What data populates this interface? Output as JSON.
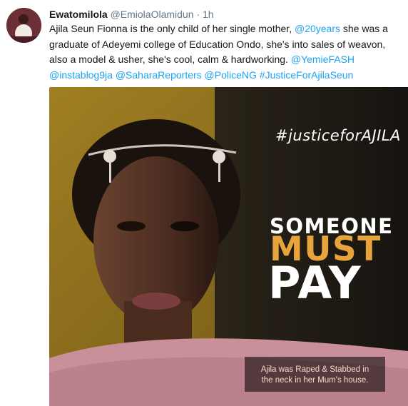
{
  "tweet": {
    "display_name": "Ewatomilola",
    "handle": "@EmiolaOlamidun",
    "separator": "·",
    "time": "1h",
    "text_parts": [
      {
        "text": "Ajila Seun Fionna is the only child of her single mother, ",
        "link": false
      },
      {
        "text": "@20years",
        "link": true
      },
      {
        "text": " she was a graduate of Adeyemi college of Education Ondo, she's into sales of weavon, also a model & usher, she's cool, calm & hardworking. ",
        "link": false
      },
      {
        "text": "@YemieFASH",
        "link": true
      },
      {
        "text": " ",
        "link": false
      },
      {
        "text": "@instablog9ja",
        "link": true
      },
      {
        "text": " ",
        "link": false
      },
      {
        "text": "@SaharaReporters",
        "link": true
      },
      {
        "text": " ",
        "link": false
      },
      {
        "text": "@PoliceNG",
        "link": true
      },
      {
        "text": " ",
        "link": false
      },
      {
        "text": "#JusticeForAjilaSeun",
        "link": true
      }
    ]
  },
  "media": {
    "hashtag": "#justiceforAJILA",
    "headline_line1": "SOMEONE",
    "headline_line2": "MUST",
    "headline_line3": "PAY",
    "caption_line1": "Ajila was Raped & Stabbed in",
    "caption_line2": "the neck in her Mum's house."
  },
  "colors": {
    "link": "#1da1f2",
    "muted": "#657786",
    "accent_orange": "#e8a43c",
    "image_left_bg": "#8a6a1c",
    "image_right_bg": "#1b1712"
  }
}
